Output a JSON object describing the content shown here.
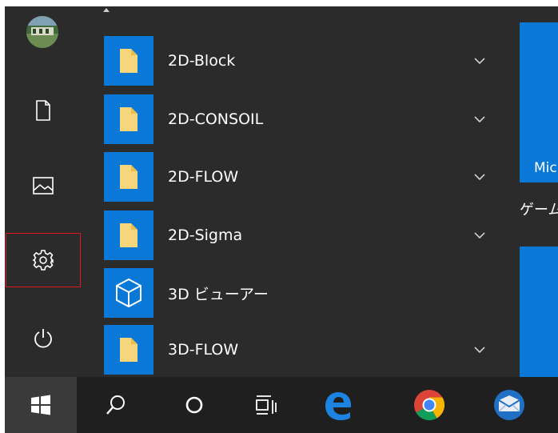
{
  "rail": {
    "items": [
      {
        "name": "avatar",
        "icon": "user-avatar-icon"
      },
      {
        "name": "documents",
        "icon": "document-icon"
      },
      {
        "name": "pictures",
        "icon": "picture-icon"
      },
      {
        "name": "settings",
        "icon": "gear-icon",
        "highlighted": true
      },
      {
        "name": "power",
        "icon": "power-icon"
      }
    ],
    "highlight_color": "#e0161e"
  },
  "apps": [
    {
      "label": "2D-Block",
      "icon": "folder-icon",
      "expandable": true
    },
    {
      "label": "2D-CONSOIL",
      "icon": "folder-icon",
      "expandable": true
    },
    {
      "label": "2D-FLOW",
      "icon": "folder-icon",
      "expandable": true
    },
    {
      "label": "2D-Sigma",
      "icon": "folder-icon",
      "expandable": true
    },
    {
      "label": "3D ビューアー",
      "icon": "cube-icon",
      "expandable": false
    },
    {
      "label": "3D-FLOW",
      "icon": "folder-icon",
      "expandable": true
    }
  ],
  "tiles": {
    "top_tile_label": "Mic",
    "group_label": "ゲーム"
  },
  "taskbar": {
    "items": [
      "start-windows-icon",
      "search-icon",
      "cortana-icon",
      "task-view-icon",
      "edge-icon",
      "chrome-icon",
      "mail-icon"
    ]
  },
  "colors": {
    "tile_blue": "#0a78d7",
    "menu_bg": "#2b2b2b",
    "taskbar_bg": "#1f1f1f",
    "folder_yellow": "#f6d67a"
  }
}
